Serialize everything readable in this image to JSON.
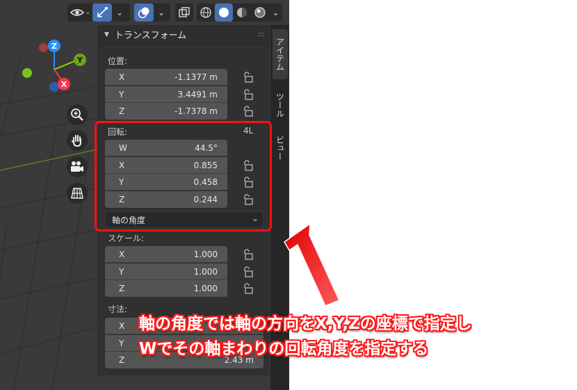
{
  "header": {
    "visibility_icon": "eye-icon",
    "gizmo_icon": "gizmo-icon",
    "overlay_icon": "overlay-icon",
    "xray_icon": "xray-icon",
    "shading_icons": [
      "wireframe-icon",
      "solid-icon",
      "material-preview-icon",
      "rendered-icon"
    ],
    "dropdown_glyph": "⌄"
  },
  "gizmo": {
    "z_label": "Z",
    "y_label": "Y",
    "x_label": "X"
  },
  "nav_buttons": [
    "zoom-icon",
    "hand-icon",
    "camera-icon",
    "grid-icon"
  ],
  "panel": {
    "title": "トランスフォーム",
    "location": {
      "label": "位置:",
      "rows": [
        {
          "axis": "X",
          "value": "-1.1377 m"
        },
        {
          "axis": "Y",
          "value": "3.4491 m"
        },
        {
          "axis": "Z",
          "value": "-1.7378 m"
        }
      ]
    },
    "rotation": {
      "label": "回転:",
      "badge": "4L",
      "rows": [
        {
          "axis": "W",
          "value": "44.5°"
        },
        {
          "axis": "X",
          "value": "0.855"
        },
        {
          "axis": "Y",
          "value": "0.458"
        },
        {
          "axis": "Z",
          "value": "0.244"
        }
      ],
      "mode": "軸の角度"
    },
    "scale": {
      "label": "スケール:",
      "rows": [
        {
          "axis": "X",
          "value": "1.000"
        },
        {
          "axis": "Y",
          "value": "1.000"
        },
        {
          "axis": "Z",
          "value": "1.000"
        }
      ]
    },
    "dimensions": {
      "label": "寸法:",
      "rows": [
        {
          "axis": "X",
          "value": ""
        },
        {
          "axis": "Y",
          "value": ""
        },
        {
          "axis": "Z",
          "value": "2.43 m"
        }
      ]
    }
  },
  "tabs": [
    "アイテム",
    "ツール",
    "ビュー"
  ],
  "annotation": {
    "line1": "軸の角度では軸の方向をX,Y,Zの座標で指定し",
    "line2": "Wでその軸まわりの回転角度を指定する",
    "color": "#ff1a1a"
  },
  "colors": {
    "accent": "#4772b3",
    "x_axis": "#ff3352",
    "y_axis": "#8bdc00",
    "z_axis": "#2890ff"
  }
}
